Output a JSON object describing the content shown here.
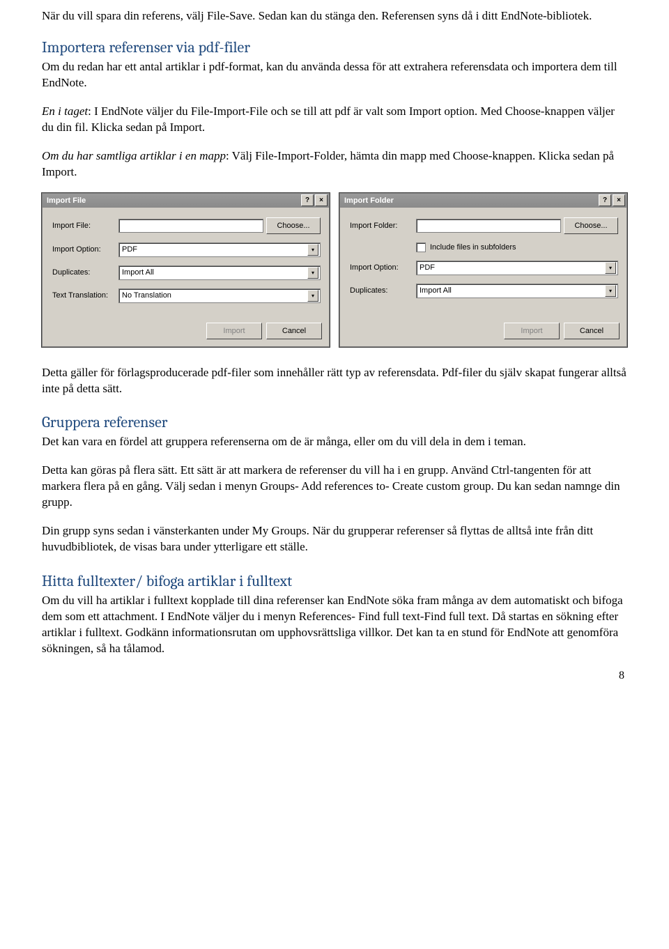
{
  "text": {
    "p1": "När du vill spara din referens, välj File-Save. Sedan kan du stänga den. Referensen syns då i ditt EndNote-bibliotek.",
    "h1": "Importera referenser via pdf-filer",
    "p2": "Om du redan har ett antal artiklar i pdf-format, kan du använda dessa för att extrahera referensdata och importera dem till EndNote.",
    "p3_em": "En i taget",
    "p3_rest": ": I EndNote väljer du File-Import-File och se till att pdf är valt som Import option. Med Choose-knappen väljer du din fil. Klicka sedan på Import.",
    "p4_em": "Om du har samtliga artiklar i en mapp",
    "p4_rest": ": Välj File-Import-Folder, hämta din mapp med Choose-knappen. Klicka sedan på Import.",
    "p5": "Detta gäller för förlagsproducerade pdf-filer som innehåller rätt typ av referensdata. Pdf-filer du själv skapat fungerar alltså inte på detta sätt.",
    "h2": "Gruppera referenser",
    "p6": "Det kan vara en fördel att gruppera referenserna om de är många, eller om du vill dela in dem i teman.",
    "p7": "Detta kan göras på flera sätt. Ett sätt är att markera de referenser du vill ha i en grupp. Använd Ctrl-tangenten för att markera flera på en gång. Välj sedan i menyn Groups- Add references to- Create custom group. Du kan sedan namnge din grupp.",
    "p8": "Din grupp syns sedan i vänsterkanten under My Groups. När du grupperar referenser så flyttas de alltså inte från ditt huvudbibliotek, de visas bara under ytterligare ett ställe.",
    "h3": "Hitta fulltexter/ bifoga artiklar i fulltext",
    "p9": "Om du vill ha artiklar i fulltext kopplade till dina referenser kan EndNote söka fram många av dem automatiskt och bifoga dem som ett attachment. I EndNote väljer du i menyn References- Find full text-Find full text. Då startas en sökning efter artiklar i fulltext. Godkänn informationsrutan om upphovsrättsliga villkor. Det kan ta en stund för EndNote att genomföra sökningen, så ha tålamod.",
    "page_number": "8"
  },
  "dialog_file": {
    "title": "Import File",
    "help": "?",
    "close": "×",
    "labels": {
      "file": "Import File:",
      "option": "Import Option:",
      "dup": "Duplicates:",
      "trans": "Text Translation:"
    },
    "values": {
      "file": "",
      "option": "PDF",
      "dup": "Import All",
      "trans": "No Translation"
    },
    "buttons": {
      "choose": "Choose...",
      "import": "Import",
      "cancel": "Cancel"
    }
  },
  "dialog_folder": {
    "title": "Import Folder",
    "help": "?",
    "close": "×",
    "labels": {
      "folder": "Import Folder:",
      "subfolders": "Include files in subfolders",
      "option": "Import Option:",
      "dup": "Duplicates:"
    },
    "values": {
      "folder": "",
      "option": "PDF",
      "dup": "Import All"
    },
    "buttons": {
      "choose": "Choose...",
      "import": "Import",
      "cancel": "Cancel"
    }
  },
  "icons": {
    "dropdown_arrow": "▾"
  }
}
